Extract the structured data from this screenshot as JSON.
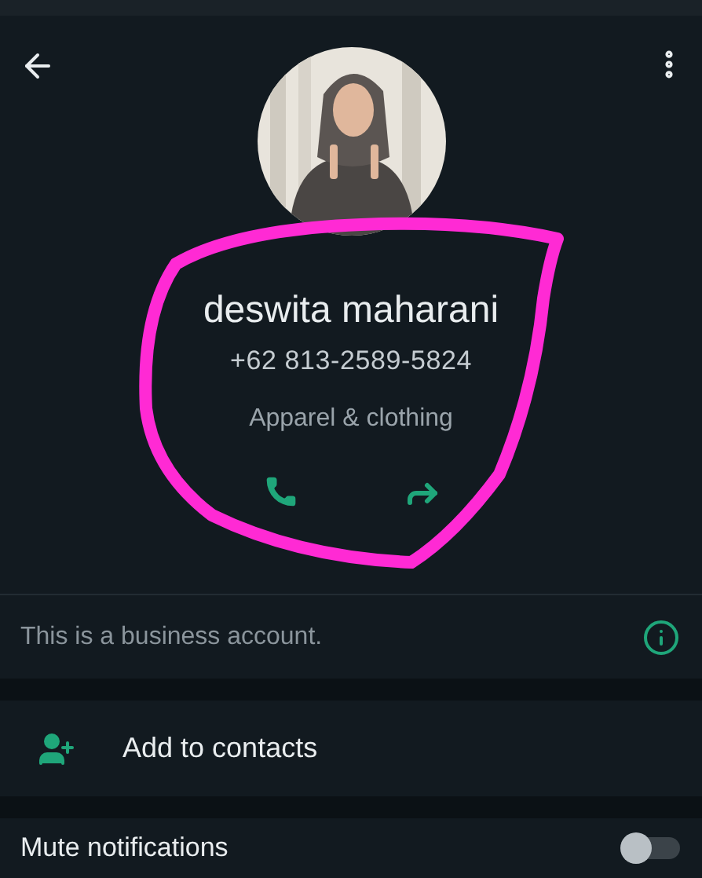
{
  "profile": {
    "name": "deswita maharani",
    "phone": "+62 813-2589-5824",
    "category": "Apparel & clothing"
  },
  "actions": [
    {
      "kind": "call"
    },
    {
      "kind": "share"
    }
  ],
  "business_note": {
    "text": "This is a business account."
  },
  "add_contact": {
    "label": "Add to contacts"
  },
  "mute": {
    "label": "Mute notifications",
    "on": false
  }
}
